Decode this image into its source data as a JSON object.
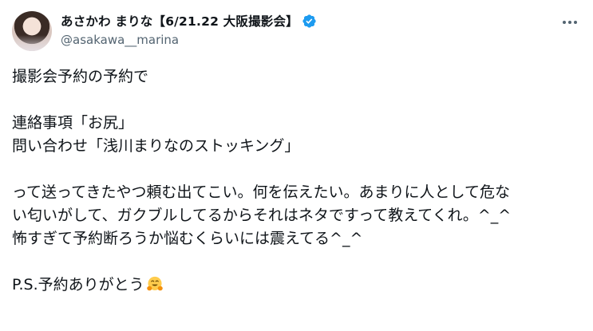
{
  "post": {
    "author": {
      "display_name": "あさかわ まりな【6/21.22 大阪撮影会】",
      "handle": "@asakawa__marina",
      "verified": true,
      "verified_color": "#1d9bf0"
    },
    "more_icon": "more-horizontal-icon",
    "text_lines": {
      "l1": "撮影会予約の予約で",
      "l2": "連絡事項「お尻」",
      "l3": "問い合わせ「浅川まりなのストッキング」",
      "l4": "って送ってきたやつ頼む出てこい。何を伝えたい。あまりに人として危な",
      "l5": "い匂いがして、ガクブルしてるからそれはネタですって教えてくれ。^_^",
      "l6": "怖すぎて予約断ろうか悩むくらいには震えてる^_^",
      "l7": "P.S.予約ありがとう"
    },
    "trailing_emoji": "hugging-face-emoji"
  }
}
